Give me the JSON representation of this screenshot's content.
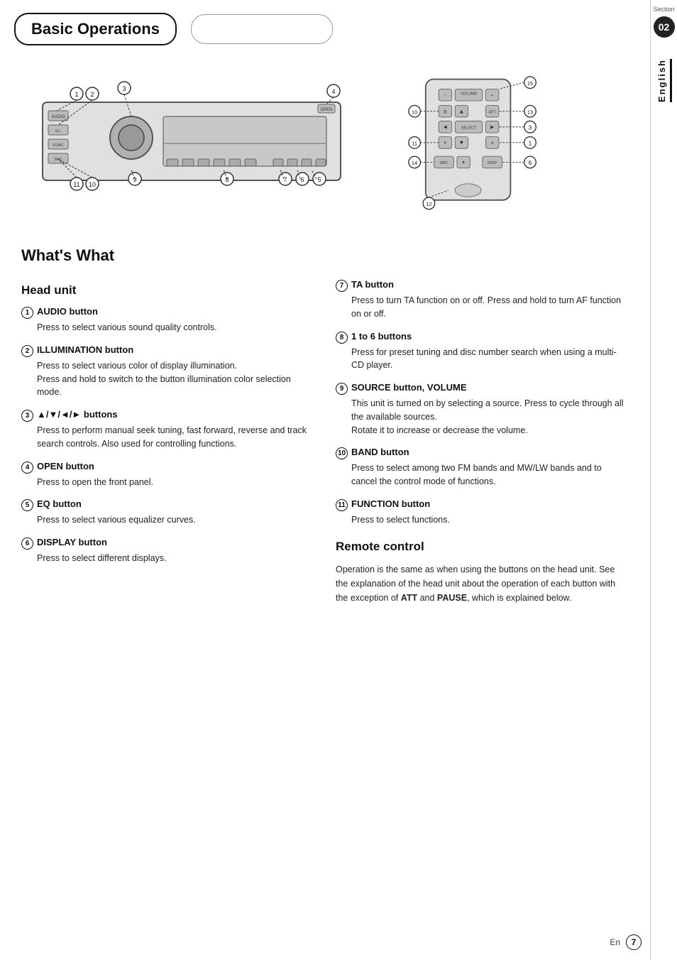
{
  "header": {
    "title": "Basic Operations",
    "section_label": "Section",
    "section_number": "02"
  },
  "sidebar": {
    "english_label": "English"
  },
  "whats_what": {
    "title": "What's What",
    "head_unit": {
      "subtitle": "Head unit",
      "items": [
        {
          "num": "①",
          "circle_num": "1",
          "label": "AUDIO button",
          "text": "Press to select various sound quality controls."
        },
        {
          "num": "②",
          "circle_num": "2",
          "label": "ILLUMINATION button",
          "text": "Press to select various color of display illumination.\nPress and hold to switch to the button illumination color selection mode."
        },
        {
          "num": "③",
          "circle_num": "3",
          "label": "▲/▼/◄/► buttons",
          "text": "Press to perform manual seek tuning, fast forward, reverse and track search controls. Also used for controlling functions."
        },
        {
          "num": "④",
          "circle_num": "4",
          "label": "OPEN button",
          "text": "Press to open the front panel."
        },
        {
          "num": "⑤",
          "circle_num": "5",
          "label": "EQ button",
          "text": "Press to select various equalizer curves."
        },
        {
          "num": "⑥",
          "circle_num": "6",
          "label": "DISPLAY button",
          "text": "Press to select different displays."
        }
      ]
    },
    "right_items": [
      {
        "circle_num": "7",
        "label": "TA button",
        "text": "Press to turn TA function on or off. Press and hold to turn AF function on or off."
      },
      {
        "circle_num": "8",
        "label": "1 to 6 buttons",
        "text": "Press for preset tuning and disc number search when using a multi-CD player."
      },
      {
        "circle_num": "9",
        "label": "SOURCE button, VOLUME",
        "text": "This unit is turned on by selecting a source. Press to cycle through all the available sources.\nRotate it to increase or decrease the volume."
      },
      {
        "circle_num": "10",
        "label": "BAND button",
        "text": "Press to select among two FM bands and MW/LW bands and to cancel the control mode of functions."
      },
      {
        "circle_num": "11",
        "label": "FUNCTION button",
        "text": "Press to select functions."
      }
    ],
    "remote_control": {
      "subtitle": "Remote control",
      "text": "Operation is the same as when using the buttons on the head unit. See the explanation of the head unit about the operation of each button with the exception of ATT and PAUSE, which is explained below."
    }
  },
  "footer": {
    "en_label": "En",
    "page_number": "7"
  }
}
